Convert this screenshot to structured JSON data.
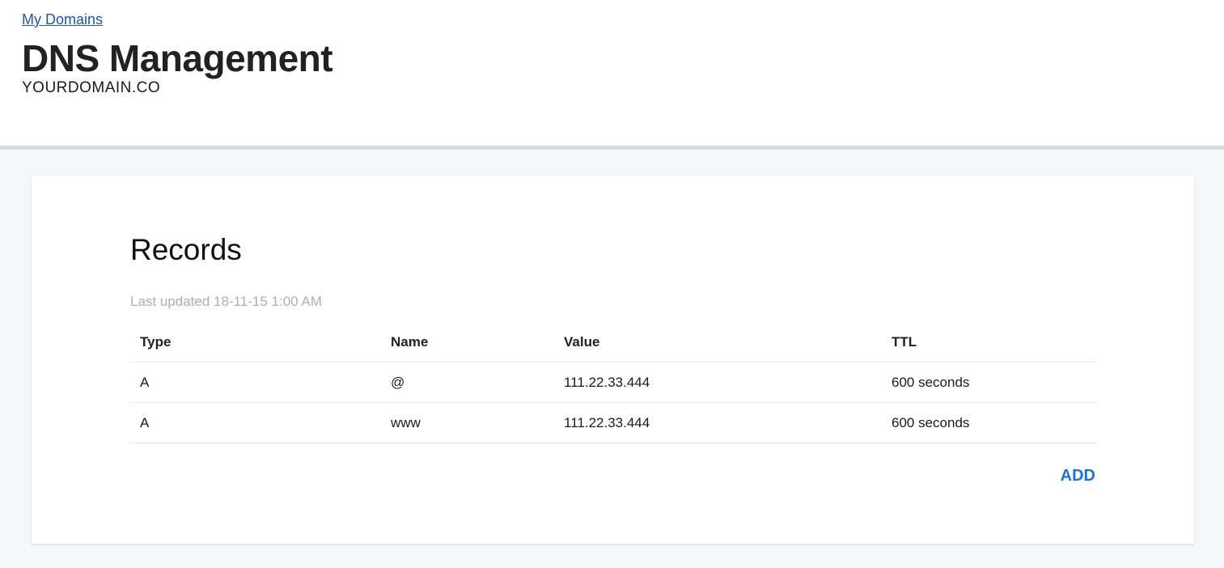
{
  "header": {
    "breadcrumb": "My Domains",
    "title": "DNS Management",
    "domain": "YOURDOMAIN.CO"
  },
  "records": {
    "title": "Records",
    "last_updated": "Last updated 18-11-15 1:00 AM",
    "columns": [
      "Type",
      "Name",
      "Value",
      "TTL"
    ],
    "rows": [
      {
        "type": "A",
        "name": "@",
        "value": "111.22.33.444",
        "ttl": "600 seconds"
      },
      {
        "type": "A",
        "name": "www",
        "value": "111.22.33.444",
        "ttl": "600 seconds"
      }
    ],
    "add_label": "ADD"
  },
  "colors": {
    "link": "#1f56a8",
    "accent": "#1f73d0",
    "muted_text": "#a9b0b6",
    "page_background": "#f5f7f8"
  }
}
